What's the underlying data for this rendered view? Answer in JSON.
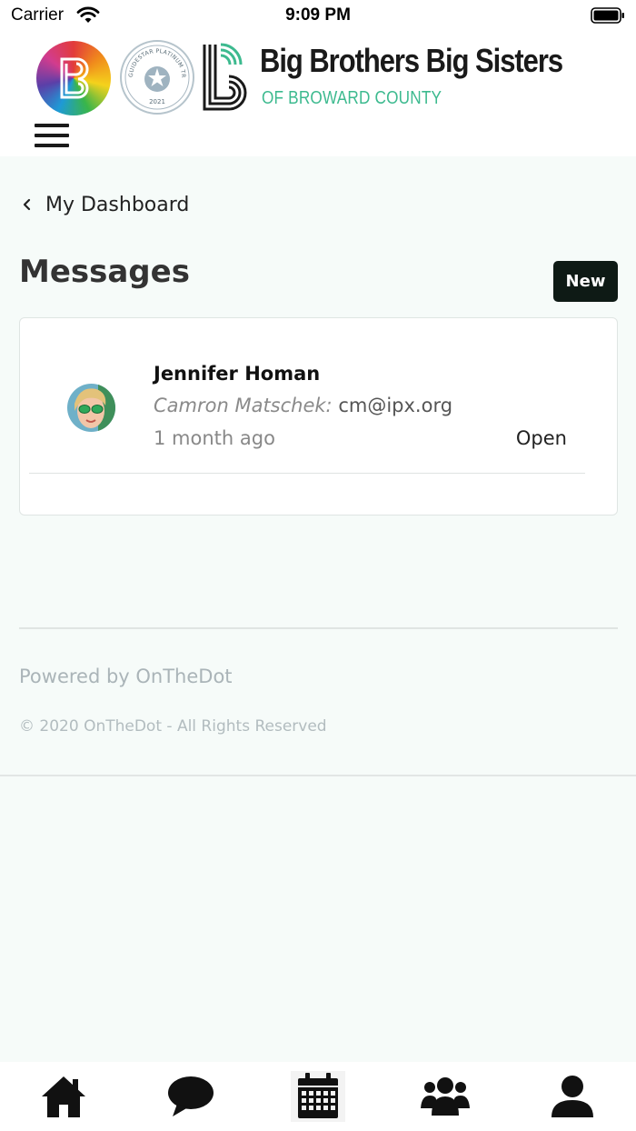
{
  "status_bar": {
    "carrier": "Carrier",
    "time": "9:09 PM"
  },
  "header": {
    "org_name": "Big Brothers Big Sisters",
    "org_subtitle": "OF BROWARD COUNTY",
    "seal_text": "GUIDESTAR PLATINUM TRANSPARENCY",
    "seal_year": "2021",
    "brand_color": "#3dba8f"
  },
  "nav": {
    "back_label": "My Dashboard"
  },
  "page": {
    "title": "Messages",
    "new_button_label": "New"
  },
  "messages": [
    {
      "recipient": "Jennifer Homan",
      "sender": "Camron Matschek:",
      "email": "cm@ipx.org",
      "time": "1 month ago",
      "status": "Open"
    }
  ],
  "footer": {
    "powered_by": "Powered by OnTheDot",
    "copyright": "© 2020 OnTheDot - All Rights Reserved"
  },
  "tab_bar": {
    "tabs": [
      {
        "icon": "home-icon"
      },
      {
        "icon": "chat-bubble-icon"
      },
      {
        "icon": "calendar-icon",
        "active": true
      },
      {
        "icon": "users-icon"
      },
      {
        "icon": "profile-icon"
      }
    ]
  }
}
